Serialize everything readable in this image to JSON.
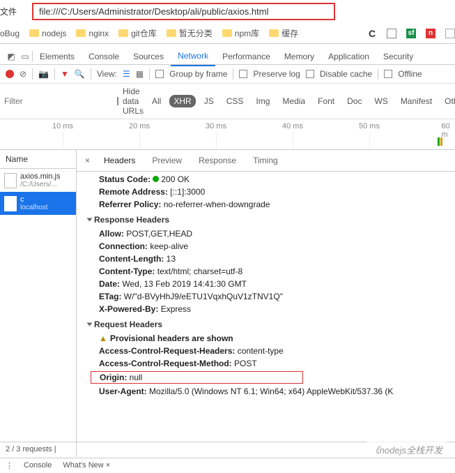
{
  "url": {
    "label": "文件",
    "value": "file:///C:/Users/Administrator/Desktop/ali/public/axios.html"
  },
  "bookmarks": {
    "left_label": "oBug",
    "items": [
      "nodejs",
      "nginx",
      "git仓库",
      "暂无分类",
      "npm库",
      "缓存"
    ],
    "right_icons": [
      "C",
      "▣",
      "sf",
      "n",
      "▣"
    ]
  },
  "devtools": {
    "tabs": [
      "Elements",
      "Console",
      "Sources",
      "Network",
      "Performance",
      "Memory",
      "Application",
      "Security"
    ],
    "active": "Network"
  },
  "toolbar": {
    "view_label": "View:",
    "group": "Group by frame",
    "preserve": "Preserve log",
    "disable": "Disable cache",
    "offline": "Offline"
  },
  "filter": {
    "placeholder": "Filter",
    "hide": "Hide data URLs",
    "types": [
      "All",
      "XHR",
      "JS",
      "CSS",
      "Img",
      "Media",
      "Font",
      "Doc",
      "WS",
      "Manifest",
      "Other"
    ],
    "active": "XHR"
  },
  "timeline": {
    "ticks": [
      "10 ms",
      "20 ms",
      "30 ms",
      "40 ms",
      "50 ms",
      "60 m"
    ]
  },
  "name_col": {
    "header": "Name",
    "items": [
      {
        "name": "axios.min.js",
        "sub": "/C:/Users/...",
        "selected": false
      },
      {
        "name": "c",
        "sub": "localhost",
        "selected": true
      }
    ]
  },
  "details": {
    "tabs": [
      "Headers",
      "Preview",
      "Response",
      "Timing"
    ],
    "active": "Headers",
    "general": {
      "status_code_label": "Status Code:",
      "status_code": "200  OK",
      "remote_label": "Remote Address:",
      "remote": "[::1]:3000",
      "ref_label": "Referrer Policy:",
      "ref": "no-referrer-when-downgrade"
    },
    "response_headers": {
      "title": "Response Headers",
      "items": [
        {
          "k": "Allow:",
          "v": "POST,GET,HEAD"
        },
        {
          "k": "Connection:",
          "v": "keep-alive"
        },
        {
          "k": "Content-Length:",
          "v": "13"
        },
        {
          "k": "Content-Type:",
          "v": "text/html; charset=utf-8"
        },
        {
          "k": "Date:",
          "v": "Wed, 13 Feb 2019 14:41:30 GMT"
        },
        {
          "k": "ETag:",
          "v": "W/\"d-BVyHhJ9/eETU1VqxhQuV1zTNV1Q\""
        },
        {
          "k": "X-Powered-By:",
          "v": "Express"
        }
      ]
    },
    "request_headers": {
      "title": "Request Headers",
      "provisional": "Provisional headers are shown",
      "items": [
        {
          "k": "Access-Control-Request-Headers:",
          "v": "content-type"
        },
        {
          "k": "Access-Control-Request-Method:",
          "v": "POST"
        },
        {
          "k": "Origin:",
          "v": "null",
          "boxed": true
        },
        {
          "k": "User-Agent:",
          "v": "Mozilla/5.0 (Windows NT 6.1; Win64; x64) AppleWebKit/537.36 (K"
        }
      ]
    }
  },
  "footer": {
    "text": "2 / 3 requests  |  "
  },
  "drawer": {
    "console": "Console",
    "whatsnew": "What's New ×"
  },
  "watermark": "《nodejs全栈开发"
}
